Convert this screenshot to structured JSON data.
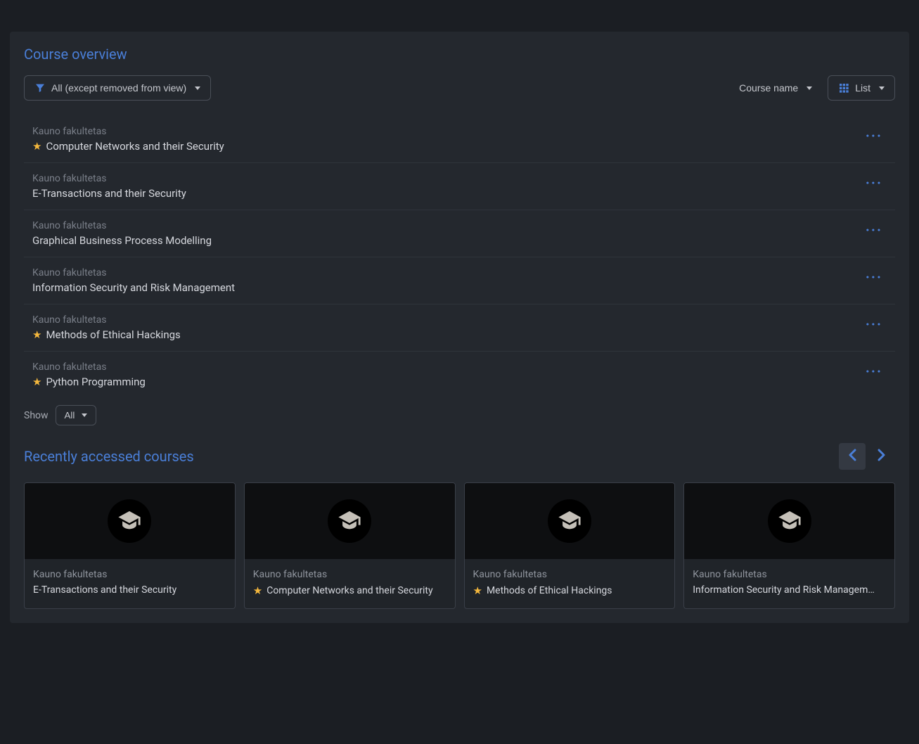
{
  "overview": {
    "title": "Course overview",
    "filter_label": "All (except removed from view)",
    "sort_label": "Course name",
    "view_label": "List",
    "show_label": "Show",
    "show_value": "All",
    "courses": [
      {
        "category": "Kauno fakultetas",
        "name": "Computer Networks and their Security",
        "starred": true
      },
      {
        "category": "Kauno fakultetas",
        "name": "E-Transactions and their Security",
        "starred": false
      },
      {
        "category": "Kauno fakultetas",
        "name": "Graphical Business Process Modelling",
        "starred": false
      },
      {
        "category": "Kauno fakultetas",
        "name": "Information Security and Risk Management",
        "starred": false
      },
      {
        "category": "Kauno fakultetas",
        "name": "Methods of Ethical Hackings",
        "starred": true
      },
      {
        "category": "Kauno fakultetas",
        "name": "Python Programming",
        "starred": true
      }
    ]
  },
  "recent": {
    "title": "Recently accessed courses",
    "cards": [
      {
        "category": "Kauno fakultetas",
        "name": "E-Transactions and their Security",
        "starred": false
      },
      {
        "category": "Kauno fakultetas",
        "name": "Computer Networks and their Security",
        "starred": true
      },
      {
        "category": "Kauno fakultetas",
        "name": "Methods of Ethical Hackings",
        "starred": true
      },
      {
        "category": "Kauno fakultetas",
        "name": "Information Security and Risk Managem…",
        "starred": false
      }
    ]
  }
}
